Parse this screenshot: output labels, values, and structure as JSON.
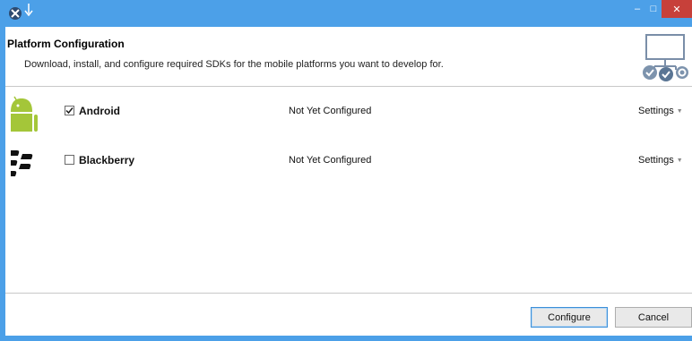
{
  "window": {
    "min_glyph": "–",
    "max_glyph": "□",
    "close_glyph": "✕",
    "accent_color": "#4ca0e8"
  },
  "header": {
    "title": "Platform Configuration",
    "description": "Download, install, and configure required SDKs for the mobile platforms you want to develop for."
  },
  "platforms": [
    {
      "name": "Android",
      "checked": true,
      "status": "Not Yet Configured",
      "settings_label": "Settings",
      "icon": "android-icon"
    },
    {
      "name": "Blackberry",
      "checked": false,
      "status": "Not Yet Configured",
      "settings_label": "Settings",
      "icon": "blackberry-icon"
    }
  ],
  "footer": {
    "configure_label": "Configure",
    "cancel_label": "Cancel"
  }
}
